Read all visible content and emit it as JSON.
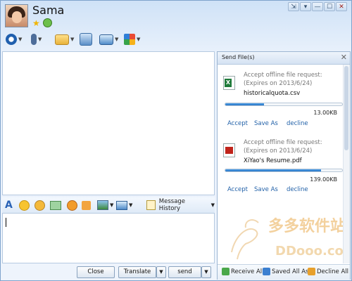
{
  "window": {
    "controls": [
      "⇲",
      "▾",
      "—",
      "☐",
      "✕"
    ]
  },
  "contact": {
    "name": "Sama"
  },
  "toolbar": {
    "icons": [
      "video-call-icon",
      "voice-call-icon",
      "folder-send-icon",
      "remote-assist-icon",
      "screen-share-icon",
      "apps-grid-icon"
    ]
  },
  "format_bar": {
    "message_history_label": "Message History"
  },
  "buttons": {
    "close": "Close",
    "translate": "Translate",
    "send": "send"
  },
  "panel": {
    "title": "Send File(s)",
    "files": [
      {
        "type": "xls",
        "request_line": "Accept offline file request:",
        "expires": "(Expires on 2013/6/24)",
        "filename": "historicalquota.csv",
        "size": "13.00KB",
        "progress": 0.33,
        "actions": [
          "Accept",
          "Save As",
          "decline"
        ]
      },
      {
        "type": "pdf",
        "request_line": "Accept offline file request:",
        "expires": "(Expires on 2013/6/24)",
        "filename": "XiYao's Resume.pdf",
        "size": "139.00KB",
        "progress": 0.82,
        "actions": [
          "Accept",
          "Save As",
          "decline"
        ]
      }
    ],
    "footer": {
      "receive_all": "Receive All",
      "saved_all_as": "Saved All As",
      "decline_all": "Decline All"
    }
  },
  "watermark": {
    "cn_text": "多多软件站",
    "url_text": "DDooo.com"
  },
  "colors": {
    "accent": "#2261a8",
    "progress": "#1f6fc1",
    "window_bg": "#d6e5f5"
  }
}
